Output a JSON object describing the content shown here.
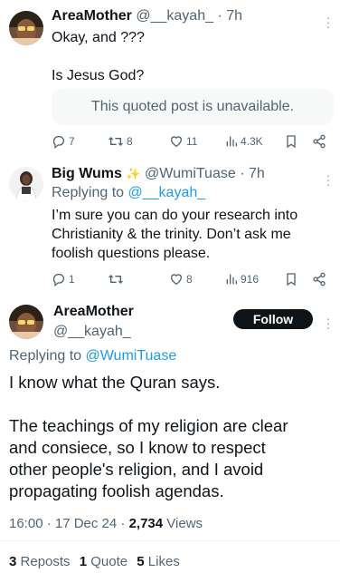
{
  "post1": {
    "display_name": "AreaMother",
    "handle": "@__kayah_",
    "time": "· 7h",
    "text_line1": "Okay, and ???",
    "text_line2": "Is Jesus God?",
    "quote_unavailable": "This quoted post is unavailable.",
    "replies": "7",
    "reposts": "8",
    "likes": "11",
    "views": "4.3K"
  },
  "post2": {
    "display_name": "Big Wums",
    "badge": "✨",
    "handle": "@WumiTuase",
    "time": "· 7h",
    "replying_prefix": "Replying to",
    "replying_handle": "@__kayah_",
    "text_line1": "I’m sure you can do your research into",
    "text_line2": "Christianity & the trinity. Don’t ask me",
    "text_line3": "foolish questions please.",
    "replies": "1",
    "reposts": "",
    "likes": "8",
    "views": "916"
  },
  "main": {
    "display_name": "AreaMother",
    "handle": "@__kayah_",
    "follow_label": "Follow",
    "replying_prefix": "Replying to",
    "replying_handle": "@WumiTuase",
    "text_line1": "I know what the Quran says.",
    "text_line2": "The teachings of my religion are clear",
    "text_line3": "and consiece, so I know to respect",
    "text_line4": "other people's religion, and I avoid",
    "text_line5": "propagating foolish agendas.",
    "time": "16:00 · 17 Dec 24 · ",
    "views_count": "2,734",
    "views_label": "Views",
    "reposts_count": "3",
    "reposts_label": "Reposts",
    "quotes_count": "1",
    "quotes_label": "Quote",
    "likes_count": "5",
    "likes_label": "Likes"
  },
  "colors": {
    "accent": "#1d9bf0",
    "text": "#0f1419",
    "secondary": "#536471"
  }
}
